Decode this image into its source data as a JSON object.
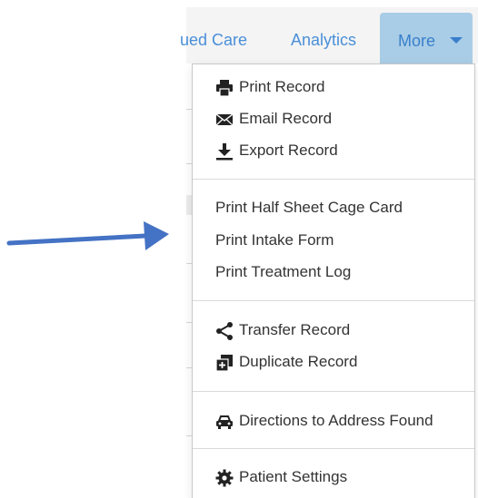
{
  "tabs": {
    "cont_label": "ued Care",
    "analytics_label": "Analytics",
    "more_label": "More"
  },
  "menu": {
    "group1": [
      {
        "label": "Print Record",
        "icon": "printer-icon"
      },
      {
        "label": "Email Record",
        "icon": "envelope-icon"
      },
      {
        "label": "Export Record",
        "icon": "download-icon"
      }
    ],
    "group2": [
      {
        "label": "Print Half Sheet Cage Card"
      },
      {
        "label": "Print Intake Form"
      },
      {
        "label": "Print Treatment Log"
      }
    ],
    "group3": [
      {
        "label": "Transfer Record",
        "icon": "share-icon"
      },
      {
        "label": "Duplicate Record",
        "icon": "duplicate-icon"
      }
    ],
    "group4": [
      {
        "label": "Directions to Address Found",
        "icon": "car-icon"
      }
    ],
    "group5": [
      {
        "label": "Patient Settings",
        "icon": "gear-icon"
      }
    ]
  },
  "colors": {
    "accent": "#4a8fd8",
    "more_tab_bg": "#a9cde6",
    "arrow": "#4472c4",
    "menu_text": "#333333"
  }
}
